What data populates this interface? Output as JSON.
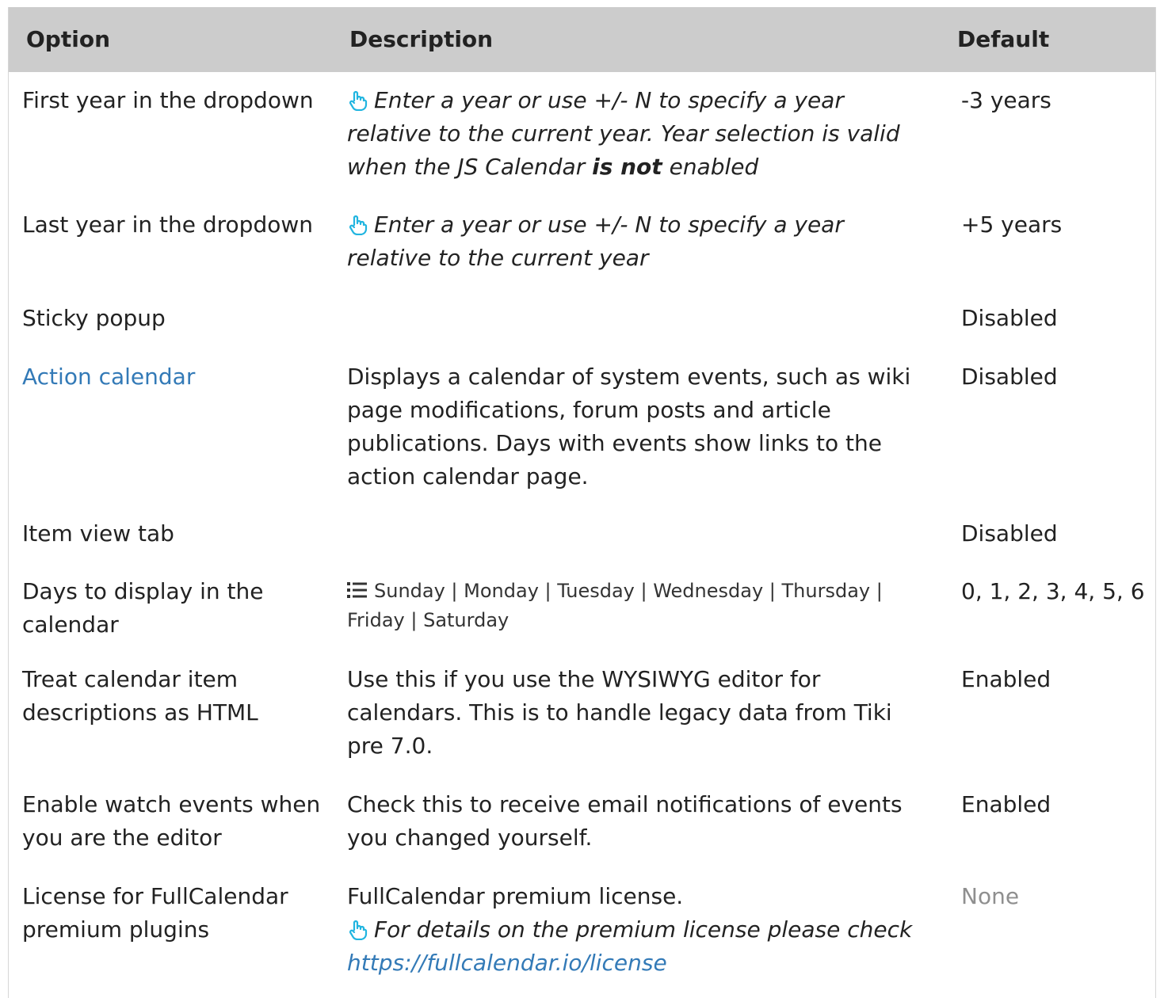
{
  "table": {
    "headers": {
      "option": "Option",
      "description": "Description",
      "default": "Default"
    },
    "rows": [
      {
        "option": "First year in the dropdown",
        "description_prefix": "Enter a year or use +/- N to specify a year relative to the current year. Year selection is valid when the JS Calendar ",
        "description_bold": "is not",
        "description_suffix": " enabled",
        "default": "-3 years"
      },
      {
        "option": "Last year in the dropdown",
        "description": "Enter a year or use +/- N to specify a year relative to the current year",
        "default": "+5 years"
      },
      {
        "option": "Sticky popup",
        "default": "Disabled"
      },
      {
        "option": "Action calendar",
        "description": "Displays a calendar of system events, such as wiki page modifications, forum posts and article publications. Days with events show links to the action calendar page.",
        "default": "Disabled"
      },
      {
        "option": "Item view tab",
        "default": "Disabled"
      },
      {
        "option": "Days to display in the calendar",
        "description": "Sunday | Monday | Tuesday | Wednesday | Thursday | Friday | Saturday",
        "default": "0, 1, 2, 3, 4, 5, 6"
      },
      {
        "option": "Treat calendar item descriptions as HTML",
        "description": "Use this if you use the WYSIWYG editor for calendars. This is to handle legacy data from Tiki pre 7.0.",
        "default": "Enabled"
      },
      {
        "option": "Enable watch events when you are the editor",
        "description": "Check this to receive email notifications of events you changed yourself.",
        "default": "Enabled"
      },
      {
        "option": "License for FullCalendar premium plugins",
        "description": "FullCalendar premium license.",
        "description_note": "For details on the premium license please check ",
        "description_link": "https://fullcalendar.io/license",
        "default": "None"
      }
    ]
  },
  "icons": {
    "hint": "pointing-hand-icon",
    "list": "list-icon"
  },
  "colors": {
    "header_bg": "#cccccc",
    "link": "#337ab7",
    "hint_icon": "#21b5e0",
    "muted": "#8f8f8f"
  }
}
